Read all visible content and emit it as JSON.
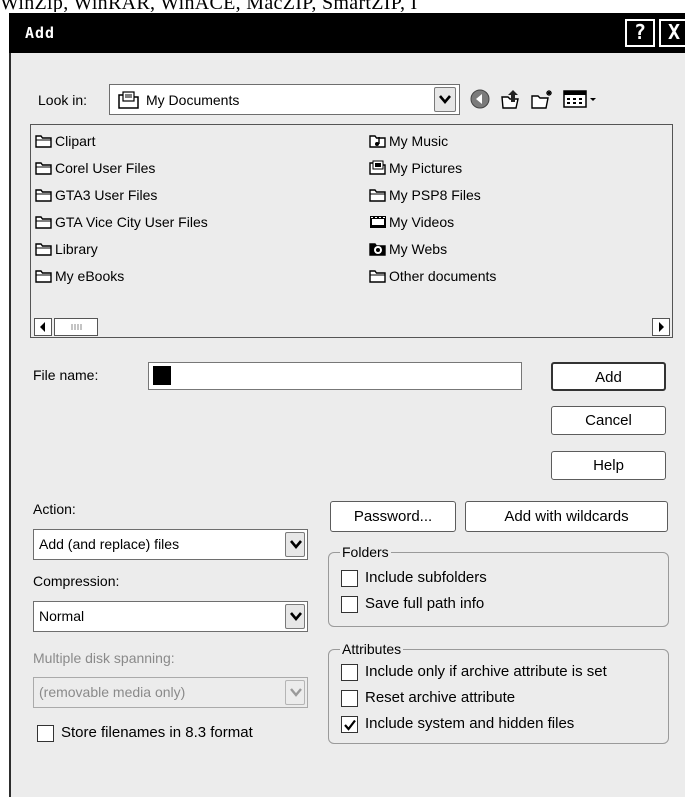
{
  "background_text": "WinZip, WinRAR, WinACE, MacZIP, SmartZIP, I",
  "window": {
    "title": "Add",
    "help_button": "?",
    "close_button": "X"
  },
  "lookin": {
    "label": "Look in:",
    "value": "My Documents"
  },
  "toolbar_icons": [
    "back-icon",
    "up-folder-icon",
    "new-folder-icon",
    "view-menu-icon"
  ],
  "files": {
    "col1": [
      {
        "name": "Clipart",
        "icon": "folder"
      },
      {
        "name": "Corel User Files",
        "icon": "folder"
      },
      {
        "name": "GTA3 User Files",
        "icon": "folder"
      },
      {
        "name": "GTA Vice City User Files",
        "icon": "folder"
      },
      {
        "name": "Library",
        "icon": "folder"
      },
      {
        "name": "My eBooks",
        "icon": "folder"
      }
    ],
    "col2": [
      {
        "name": "My Music",
        "icon": "music-folder"
      },
      {
        "name": "My Pictures",
        "icon": "pictures-folder"
      },
      {
        "name": "My PSP8 Files",
        "icon": "folder"
      },
      {
        "name": "My Videos",
        "icon": "videos-folder"
      },
      {
        "name": "My Webs",
        "icon": "webs-folder"
      },
      {
        "name": "Other documents",
        "icon": "folder"
      }
    ]
  },
  "filename": {
    "label": "File name:",
    "value": ""
  },
  "buttons": {
    "add": "Add",
    "cancel": "Cancel",
    "help": "Help",
    "password": "Password...",
    "add_wildcards": "Add with wildcards"
  },
  "action": {
    "label": "Action:",
    "value": "Add (and replace) files"
  },
  "compression": {
    "label": "Compression:",
    "value": "Normal"
  },
  "spanning": {
    "label": "Multiple disk spanning:",
    "value": "(removable media only)"
  },
  "store83": {
    "label": "Store filenames in 8.3 format",
    "checked": false
  },
  "folders": {
    "title": "Folders",
    "include_subfolders": {
      "label": "Include subfolders",
      "checked": false
    },
    "save_full_path": {
      "label": "Save full path info",
      "checked": false
    }
  },
  "attributes": {
    "title": "Attributes",
    "include_only_archive": {
      "label": "Include only if archive attribute is set",
      "checked": false
    },
    "reset_archive": {
      "label": "Reset archive attribute",
      "checked": false
    },
    "include_system_hidden": {
      "label": "Include system and hidden files",
      "checked": true
    }
  }
}
